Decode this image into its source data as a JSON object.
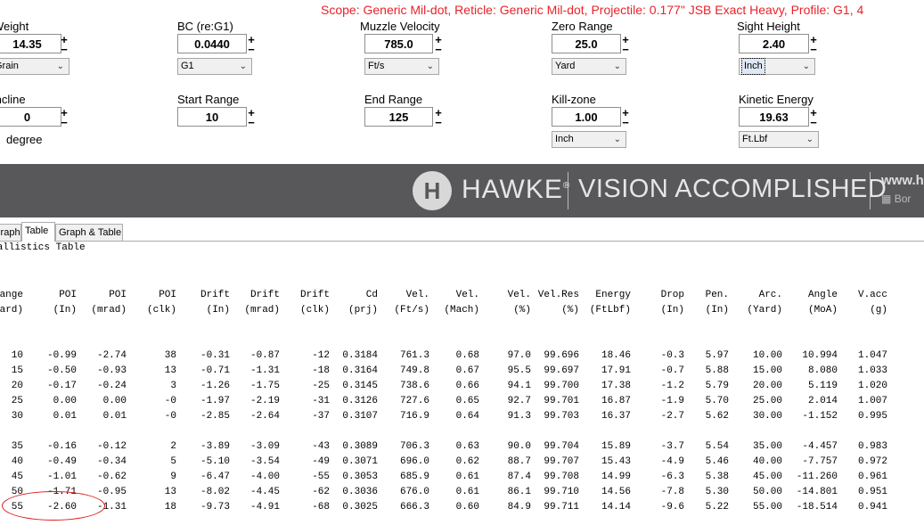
{
  "header": {
    "scope_line": "Scope: Generic Mil-dot, Reticle: Generic Mil-dot, Projectile: 0.177\" JSB Exact Heavy, Profile: G1, 4"
  },
  "fields": {
    "weight": {
      "label": "Weight",
      "value": "14.35",
      "unit": "Grain"
    },
    "bc": {
      "label": "BC (re:G1)",
      "value": "0.0440",
      "unit": "G1"
    },
    "muzzle_velocity": {
      "label": "Muzzle Velocity",
      "value": "785.0",
      "unit": "Ft/s"
    },
    "zero_range": {
      "label": "Zero Range",
      "value": "25.0",
      "unit": "Yard"
    },
    "sight_height": {
      "label": "Sight Height",
      "value": "2.40",
      "unit": "Inch"
    },
    "incline": {
      "label": "Incline",
      "value": "0",
      "unit": "degree"
    },
    "start_range": {
      "label": "Start Range",
      "value": "10"
    },
    "end_range": {
      "label": "End Range",
      "value": "125"
    },
    "kill_zone": {
      "label": "Kill-zone",
      "value": "1.00",
      "unit": "Inch"
    },
    "kinetic_energy": {
      "label": "Kinetic Energy",
      "value": "19.63",
      "unit": "Ft.Lbf"
    }
  },
  "spinner": {
    "up": "+",
    "down": "−"
  },
  "banner": {
    "logo_glyph": "H",
    "brand": "HAWKE",
    "registered": "®",
    "tagline": "VISION ACCOMPLISHED",
    "web": "www.h",
    "sub": "Bor"
  },
  "tabs": [
    "Graph",
    "Table",
    "Graph & Table"
  ],
  "table": {
    "title": "Ballistics Table",
    "headers1": [
      "Range",
      "POI",
      "POI",
      "POI",
      "Drift",
      "Drift",
      "Drift",
      "Cd",
      "Vel.",
      "Vel.",
      "Vel.",
      "Vel.Res",
      "Energy",
      "Drop",
      "Pen.",
      "Arc.",
      "Angle",
      "V.acc"
    ],
    "headers2": [
      "(Yard)",
      "(In)",
      "(mrad)",
      "(clk)",
      "(In)",
      "(mrad)",
      "(clk)",
      "(prj)",
      "(Ft/s)",
      "(Mach)",
      "(%)",
      "(%)",
      "(FtLbf)",
      "(In)",
      "(In)",
      "(Yard)",
      "(MoA)",
      "(g)"
    ],
    "group1": [
      [
        "10",
        "-0.99",
        "-2.74",
        "38",
        "-0.31",
        "-0.87",
        "-12",
        "0.3184",
        "761.3",
        "0.68",
        "97.0",
        "99.696",
        "18.46",
        "-0.3",
        "5.97",
        "10.00",
        "10.994",
        "1.047"
      ],
      [
        "15",
        "-0.50",
        "-0.93",
        "13",
        "-0.71",
        "-1.31",
        "-18",
        "0.3164",
        "749.8",
        "0.67",
        "95.5",
        "99.697",
        "17.91",
        "-0.7",
        "5.88",
        "15.00",
        "8.080",
        "1.033"
      ],
      [
        "20",
        "-0.17",
        "-0.24",
        "3",
        "-1.26",
        "-1.75",
        "-25",
        "0.3145",
        "738.6",
        "0.66",
        "94.1",
        "99.700",
        "17.38",
        "-1.2",
        "5.79",
        "20.00",
        "5.119",
        "1.020"
      ],
      [
        "25",
        "0.00",
        "0.00",
        "-0",
        "-1.97",
        "-2.19",
        "-31",
        "0.3126",
        "727.6",
        "0.65",
        "92.7",
        "99.701",
        "16.87",
        "-1.9",
        "5.70",
        "25.00",
        "2.014",
        "1.007"
      ],
      [
        "30",
        "0.01",
        "0.01",
        "-0",
        "-2.85",
        "-2.64",
        "-37",
        "0.3107",
        "716.9",
        "0.64",
        "91.3",
        "99.703",
        "16.37",
        "-2.7",
        "5.62",
        "30.00",
        "-1.152",
        "0.995"
      ]
    ],
    "group2": [
      [
        "35",
        "-0.16",
        "-0.12",
        "2",
        "-3.89",
        "-3.09",
        "-43",
        "0.3089",
        "706.3",
        "0.63",
        "90.0",
        "99.704",
        "15.89",
        "-3.7",
        "5.54",
        "35.00",
        "-4.457",
        "0.983"
      ],
      [
        "40",
        "-0.49",
        "-0.34",
        "5",
        "-5.10",
        "-3.54",
        "-49",
        "0.3071",
        "696.0",
        "0.62",
        "88.7",
        "99.707",
        "15.43",
        "-4.9",
        "5.46",
        "40.00",
        "-7.757",
        "0.972"
      ],
      [
        "45",
        "-1.01",
        "-0.62",
        "9",
        "-6.47",
        "-4.00",
        "-55",
        "0.3053",
        "685.9",
        "0.61",
        "87.4",
        "99.708",
        "14.99",
        "-6.3",
        "5.38",
        "45.00",
        "-11.260",
        "0.961"
      ],
      [
        "50",
        "-1.71",
        "-0.95",
        "13",
        "-8.02",
        "-4.45",
        "-62",
        "0.3036",
        "676.0",
        "0.61",
        "86.1",
        "99.710",
        "14.56",
        "-7.8",
        "5.30",
        "50.00",
        "-14.801",
        "0.951"
      ],
      [
        "55",
        "-2.60",
        "-1.31",
        "18",
        "-9.73",
        "-4.91",
        "-68",
        "0.3025",
        "666.3",
        "0.60",
        "84.9",
        "99.711",
        "14.14",
        "-9.6",
        "5.22",
        "55.00",
        "-18.514",
        "0.941"
      ]
    ]
  },
  "colors": {
    "scope_text": "#e8232a",
    "banner_bg": "#58585a",
    "annotation_circle": "#e01818"
  }
}
